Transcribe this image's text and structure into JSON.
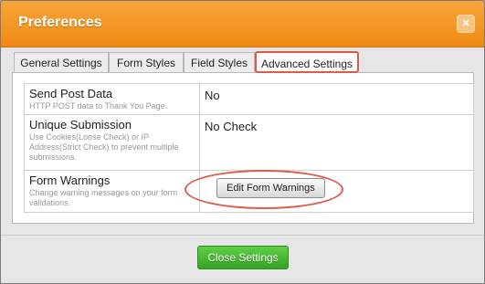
{
  "dialog": {
    "title": "Preferences",
    "close_glyph": "×"
  },
  "tabs": [
    {
      "label": "General Settings"
    },
    {
      "label": "Form Styles"
    },
    {
      "label": "Field Styles"
    },
    {
      "label": "Advanced Settings",
      "active": true
    }
  ],
  "rows": [
    {
      "title": "Send Post Data",
      "description": "HTTP POST data to Thank You Page.",
      "value": "No"
    },
    {
      "title": "Unique Submission",
      "description": "Use Cookies(Loose Check) or IP Address(Strict Check) to prevent multiple submissions.",
      "value": "No Check"
    },
    {
      "title": "Form Warnings",
      "description": "Change warning messages on your form validations.",
      "button_label": "Edit Form Warnings"
    }
  ],
  "footer": {
    "close_label": "Close Settings"
  },
  "colors": {
    "titlebar": "#ef8a14",
    "highlight": "#e05a4a",
    "close_button": "#35a322"
  }
}
